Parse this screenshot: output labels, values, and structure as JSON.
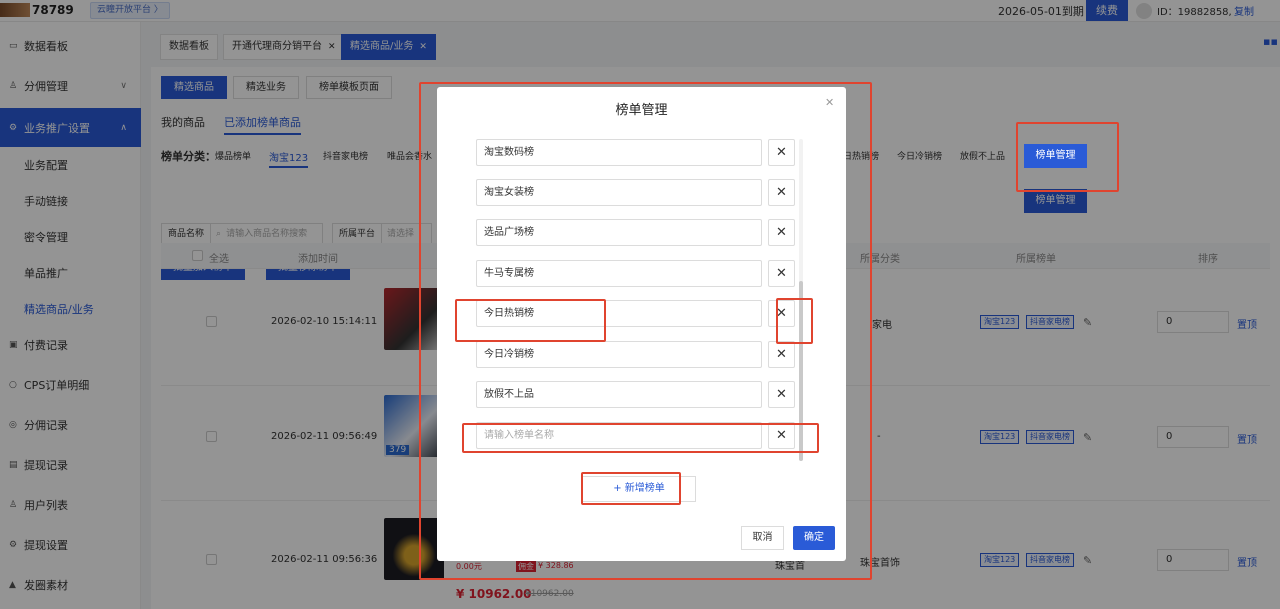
{
  "topbar": {
    "brand": "78789",
    "open_platform": "云瞳开放平台 〉",
    "expiry": "2026-05-01到期",
    "renew": "续费",
    "uid": "ID：19882858,",
    "copy": "复制"
  },
  "sidebar": {
    "items": [
      {
        "label": "数据看板",
        "icon": "dashboard-icon"
      },
      {
        "label": "分佣管理",
        "icon": "user-icon"
      },
      {
        "label": "业务推广设置",
        "icon": "settings-icon"
      },
      {
        "label": "付费记录",
        "icon": "record-icon"
      },
      {
        "label": "CPS订单明细",
        "icon": "order-icon"
      },
      {
        "label": "分佣记录",
        "icon": "commission-icon"
      },
      {
        "label": "提现记录",
        "icon": "withdraw-icon"
      },
      {
        "label": "用户列表",
        "icon": "user-list-icon"
      },
      {
        "label": "提现设置",
        "icon": "withdraw-settings-icon"
      },
      {
        "label": "发圈素材",
        "icon": "material-icon"
      }
    ],
    "sub_items": [
      "业务配置",
      "手动链接",
      "密令管理",
      "单品推广",
      "精选商品/业务"
    ]
  },
  "page_tabs": [
    "数据看板",
    "开通代理商分销平台",
    "精选商品/业务"
  ],
  "sub_tabs": [
    "精选商品",
    "精选业务",
    "榜单模板页面"
  ],
  "tabs2": [
    "我的商品",
    "已添加榜单商品"
  ],
  "categories": {
    "label": "榜单分类：",
    "items": [
      "爆品榜单",
      "淘宝123",
      "抖音家电榜",
      "唯品会香水",
      "日热销榜",
      "今日冷销榜",
      "放假不上品"
    ]
  },
  "manage_button": "榜单管理",
  "filters": {
    "name_label": "商品名称",
    "name_placeholder": "请输入商品名称搜索",
    "platform_label": "所属平台",
    "platform_placeholder": "请选择"
  },
  "batch": {
    "add": "批量加入榜单",
    "remove": "批量移除榜单"
  },
  "table": {
    "headers": [
      "全选",
      "添加时间",
      "所属分类",
      "所属榜单",
      "排序"
    ],
    "rows": [
      {
        "time": "2026-02-10 15:14:11",
        "category": "家电",
        "tags": [
          "淘宝123",
          "抖音家电榜"
        ],
        "sort": "0",
        "top": "置顶"
      },
      {
        "time": "2026-02-11 09:56:49",
        "category": "-",
        "tags": [
          "淘宝123",
          "抖音家电榜"
        ],
        "sort": "0",
        "top": "置顶"
      },
      {
        "time": "2026-02-11 09:56:36",
        "category": "珠宝首饰",
        "tags": [
          "淘宝123",
          "抖音家电榜"
        ],
        "sort": "0",
        "top": "置顶"
      }
    ],
    "row2_badge": "379",
    "row3_prices": {
      "low": "0.00元",
      "tag": "佣金",
      "commission": "¥ 328.86",
      "price": "¥ 10962.00",
      "orig": "¥10962.00"
    },
    "row3_extra": "珠宝首"
  },
  "modal": {
    "title": "榜单管理",
    "fields": [
      "淘宝数码榜",
      "淘宝女装榜",
      "选品广场榜",
      "牛马专属榜",
      "今日热销榜",
      "今日冷销榜",
      "放假不上品"
    ],
    "new_placeholder": "请输入榜单名称",
    "add_button": "+ 新增榜单",
    "cancel": "取消",
    "confirm": "确定"
  },
  "colors": {
    "accent": "#2a5bd7",
    "annotation": "#e0442f"
  }
}
